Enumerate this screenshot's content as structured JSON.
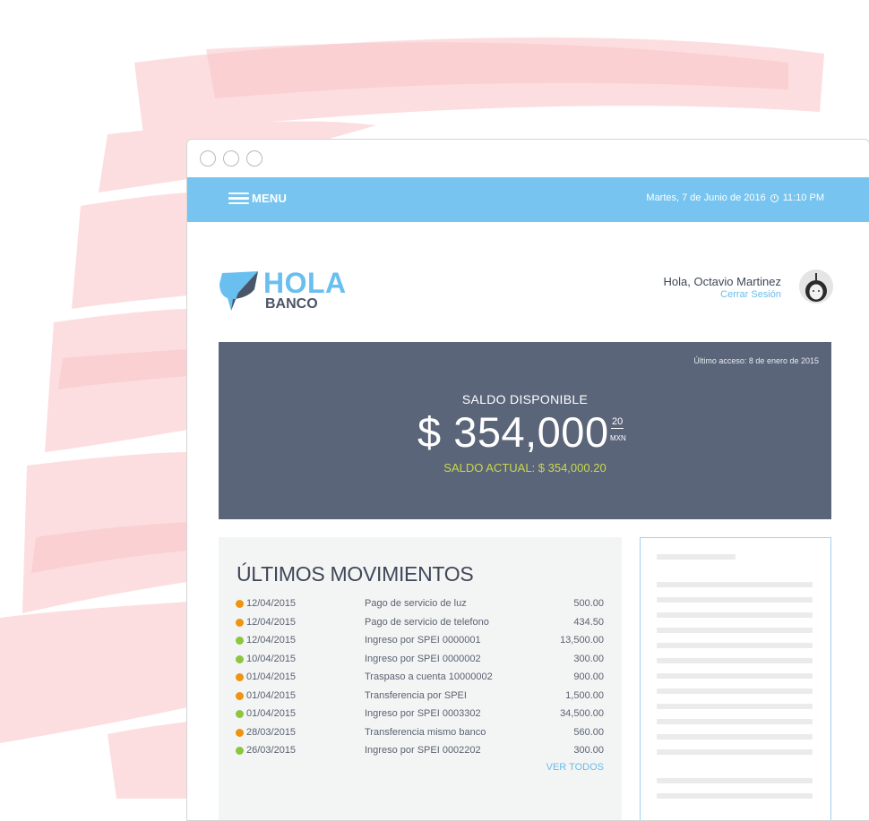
{
  "colors": {
    "accent": "#76c4ef",
    "card": "#5b6579",
    "saldo_actual": "#c9d84a",
    "link": "#6bbde8",
    "dot_orange": "#f0930f",
    "dot_green": "#8cc63f"
  },
  "topbar": {
    "menu_label": "MENU",
    "date": "Martes, 7 de Junio de 2016",
    "time": "11:10 PM"
  },
  "logo": {
    "line1": "HOLA",
    "line2": "BANCO"
  },
  "user": {
    "greeting": "Hola, Octavio Martinez",
    "logout": "Cerrar Sesión"
  },
  "balance": {
    "last_access": "Último acceso: 8 de enero de 2015",
    "label": "SALDO DISPONIBLE",
    "amount": "$ 354,000",
    "cents": "20",
    "currency": "MXN",
    "current": "SALDO ACTUAL: $ 354,000.20"
  },
  "movements": {
    "title": "ÚLTIMOS MOVIMIENTOS",
    "view_all": "VER TODOS",
    "rows": [
      {
        "status": "orange",
        "date": "12/04/2015",
        "desc": "Pago de servicio de luz",
        "amount": "500.00"
      },
      {
        "status": "orange",
        "date": "12/04/2015",
        "desc": "Pago de servicio de telefono",
        "amount": "434.50"
      },
      {
        "status": "green",
        "date": "12/04/2015",
        "desc": "Ingreso por SPEI 0000001",
        "amount": "13,500.00"
      },
      {
        "status": "green",
        "date": "10/04/2015",
        "desc": "Ingreso por SPEI 0000002",
        "amount": "300.00"
      },
      {
        "status": "orange",
        "date": "01/04/2015",
        "desc": "Traspaso a cuenta 10000002",
        "amount": "900.00"
      },
      {
        "status": "orange",
        "date": "01/04/2015",
        "desc": "Transferencia por SPEI",
        "amount": "1,500.00"
      },
      {
        "status": "green",
        "date": "01/04/2015",
        "desc": "Ingreso por SPEI 0003302",
        "amount": "34,500.00"
      },
      {
        "status": "orange",
        "date": "28/03/2015",
        "desc": "Transferencia mismo banco",
        "amount": "560.00"
      },
      {
        "status": "green",
        "date": "26/03/2015",
        "desc": "Ingreso por SPEI 0002202",
        "amount": "300.00"
      }
    ]
  }
}
